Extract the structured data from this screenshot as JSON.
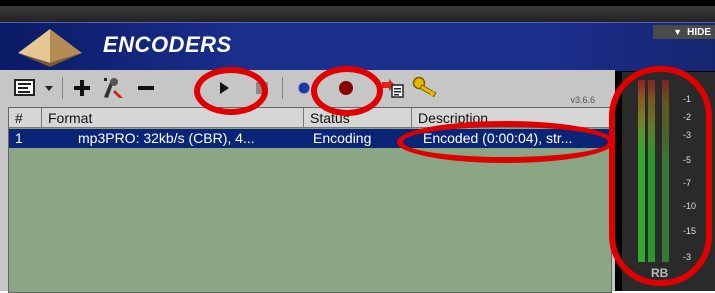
{
  "header": {
    "title": "ENCODERS",
    "hide_label": "HIDE"
  },
  "toolbar": {
    "version": "v3.6.6",
    "icons": [
      "settings-icon",
      "dropdown-arrow-icon",
      "add-icon",
      "wizard-icon",
      "remove-icon",
      "play-icon",
      "stop-icon",
      "blue-dot-icon",
      "record-icon",
      "import-icon",
      "key-icon"
    ]
  },
  "table": {
    "columns": [
      "#",
      "Format",
      "Status",
      "Description"
    ],
    "rows": [
      {
        "num": "1",
        "format": "mp3PRO: 32kb/s (CBR), 4...",
        "status": "Encoding",
        "description": "Encoded (0:00:04), str..."
      }
    ]
  },
  "meter": {
    "scale_labels": [
      "-1",
      "-2",
      "-3",
      "-5",
      "-7",
      "-10",
      "-15",
      "-3"
    ],
    "footer": "RB"
  },
  "colors": {
    "header_blue": "#1b2f8d",
    "selection_blue": "#0a2578",
    "list_green": "#8aa685",
    "annotation_red": "#e00000"
  }
}
